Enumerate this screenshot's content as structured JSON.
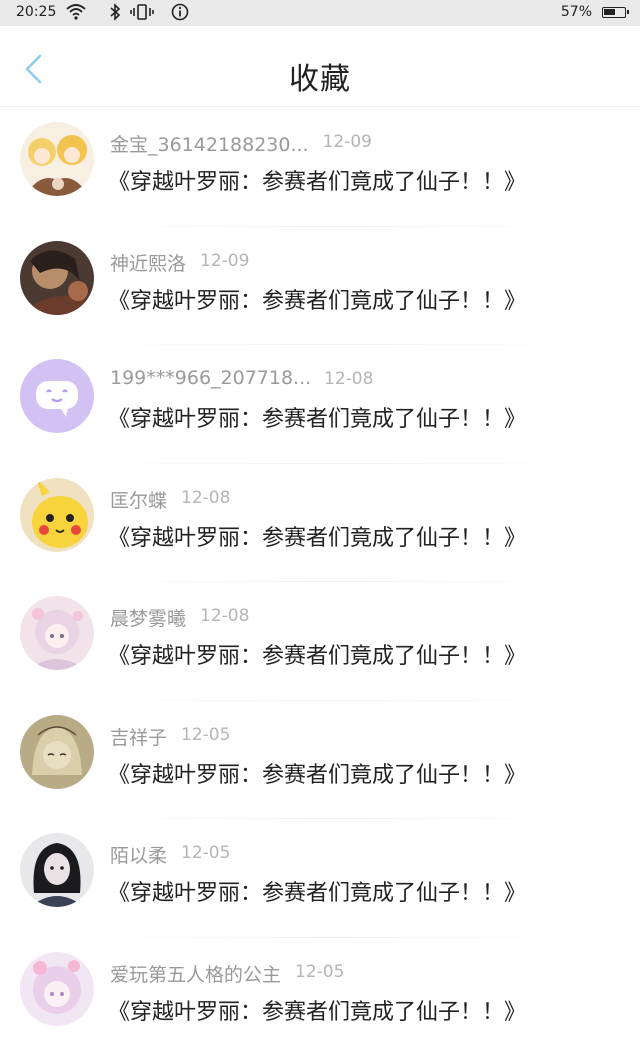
{
  "status_bar": {
    "time": "20:25",
    "battery_percent": "57%",
    "battery_level": 0.57,
    "icons": [
      "wifi-icon",
      "bluetooth-icon",
      "vibrate-icon",
      "info-icon"
    ]
  },
  "header": {
    "title": "收藏",
    "back_icon": "chevron-left-icon",
    "accent_color": "#8ecdf0"
  },
  "items": [
    {
      "username": "金宝_36142188230...",
      "date": "12-09",
      "content": "《穿越叶罗丽：参赛者们竟成了仙子！！》",
      "avatar": "anime-girl-yellow"
    },
    {
      "username": "神近熙洛",
      "date": "12-09",
      "content": "《穿越叶罗丽：参赛者们竟成了仙子！！》",
      "avatar": "dark-portrait"
    },
    {
      "username": "199***966_207718...",
      "date": "12-08",
      "content": "《穿越叶罗丽：参赛者们竟成了仙子！！》",
      "avatar": "default-chat-purple"
    },
    {
      "username": "匡尔蝶",
      "date": "12-08",
      "content": "《穿越叶罗丽：参赛者们竟成了仙子！！》",
      "avatar": "pikachu"
    },
    {
      "username": "晨梦雾曦",
      "date": "12-08",
      "content": "《穿越叶罗丽：参赛者们竟成了仙子！！》",
      "avatar": "anime-girl-pink"
    },
    {
      "username": "吉祥子",
      "date": "12-05",
      "content": "《穿越叶罗丽：参赛者们竟成了仙子！！》",
      "avatar": "sketch-girl"
    },
    {
      "username": "陌以柔",
      "date": "12-05",
      "content": "《穿越叶罗丽：参赛者们竟成了仙子！！》",
      "avatar": "dark-hair-girl"
    },
    {
      "username": "爱玩第五人格的公主",
      "date": "12-05",
      "content": "《穿越叶罗丽：参赛者们竟成了仙子！！》",
      "avatar": "anime-girl-lavender"
    }
  ]
}
